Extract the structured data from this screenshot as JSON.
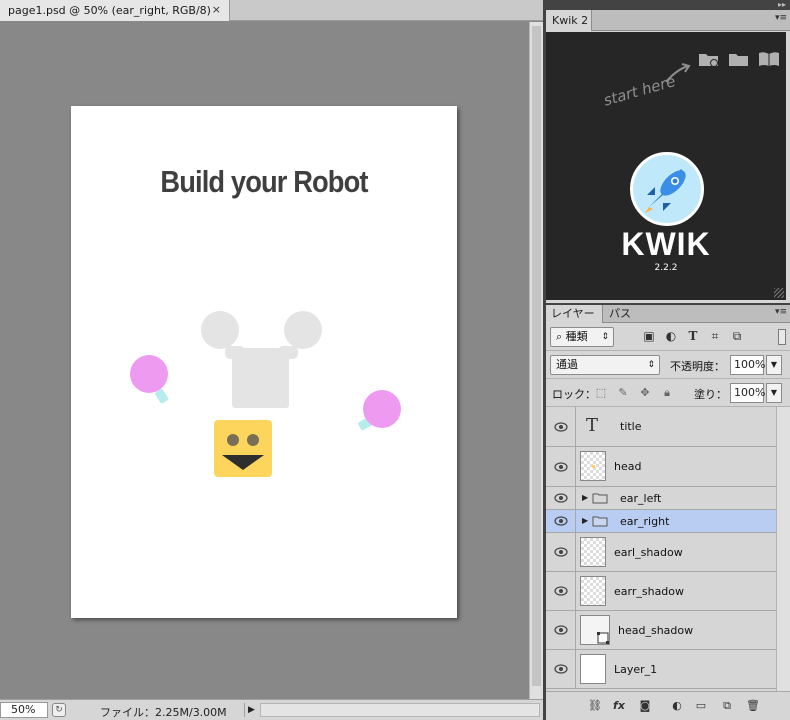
{
  "document": {
    "tab_title": "page1.psd @ 50% (ear_right, RGB/8)",
    "close_glyph": "×",
    "canvas": {
      "title": "Build your Robot"
    }
  },
  "status": {
    "zoom": "50%",
    "file_info": "ファイル：2.25M/3.00M"
  },
  "kwik": {
    "tab_label": "Kwik 2",
    "start_here": "start here",
    "brand": "KWIK",
    "version": "2.2.2"
  },
  "layers_panel": {
    "tabs": [
      "レイヤー",
      "パス"
    ],
    "filter_kind": "種類",
    "blend_mode": "通過",
    "opacity_label": "不透明度：",
    "opacity": "100%",
    "lock_label": "ロック：",
    "fill_label": "塗り：",
    "fill": "100%"
  },
  "layers": [
    {
      "name": "title",
      "kind": "text",
      "selected": false
    },
    {
      "name": "head",
      "kind": "pixel",
      "selected": false
    },
    {
      "name": "ear_left",
      "kind": "group",
      "selected": false
    },
    {
      "name": "ear_right",
      "kind": "group",
      "selected": true
    },
    {
      "name": "earl_shadow",
      "kind": "pixel",
      "selected": false
    },
    {
      "name": "earr_shadow",
      "kind": "pixel",
      "selected": false
    },
    {
      "name": "head_shadow",
      "kind": "shape",
      "selected": false
    },
    {
      "name": "Layer_1",
      "kind": "pixel",
      "selected": false
    }
  ],
  "colors": {
    "selected_layer": "#b9cdf2",
    "ear_pink": "#ee9af0",
    "head_yellow": "#fdd55c",
    "kwik_background": "#262626"
  }
}
